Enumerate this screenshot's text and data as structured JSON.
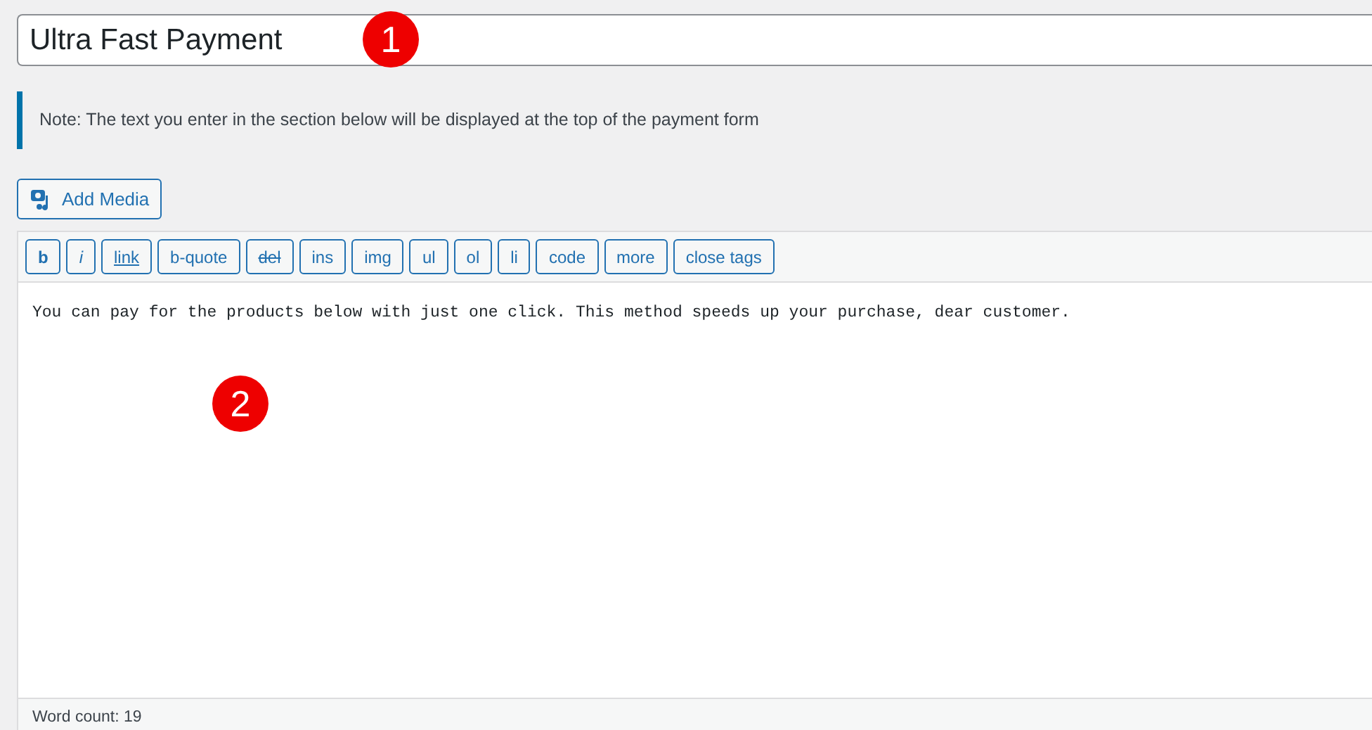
{
  "title_field": {
    "value": "Ultra Fast Payment"
  },
  "note": "Note: The text you enter in the section below will be displayed at the top of the payment form",
  "add_media_button": "Add Media",
  "toolbar": [
    {
      "label": "b",
      "kind": "bold"
    },
    {
      "label": "i",
      "kind": "italic"
    },
    {
      "label": "link",
      "kind": "underline"
    },
    {
      "label": "b-quote",
      "kind": "plain"
    },
    {
      "label": "del",
      "kind": "strike"
    },
    {
      "label": "ins",
      "kind": "plain"
    },
    {
      "label": "img",
      "kind": "plain"
    },
    {
      "label": "ul",
      "kind": "plain"
    },
    {
      "label": "ol",
      "kind": "plain"
    },
    {
      "label": "li",
      "kind": "plain"
    },
    {
      "label": "code",
      "kind": "plain"
    },
    {
      "label": "more",
      "kind": "plain"
    },
    {
      "label": "close tags",
      "kind": "plain"
    }
  ],
  "editor_text": "You can pay for the products below with just one click. This method speeds up your purchase, dear customer.",
  "status_bar": "Word count: 19",
  "callouts": [
    "1",
    "2"
  ]
}
